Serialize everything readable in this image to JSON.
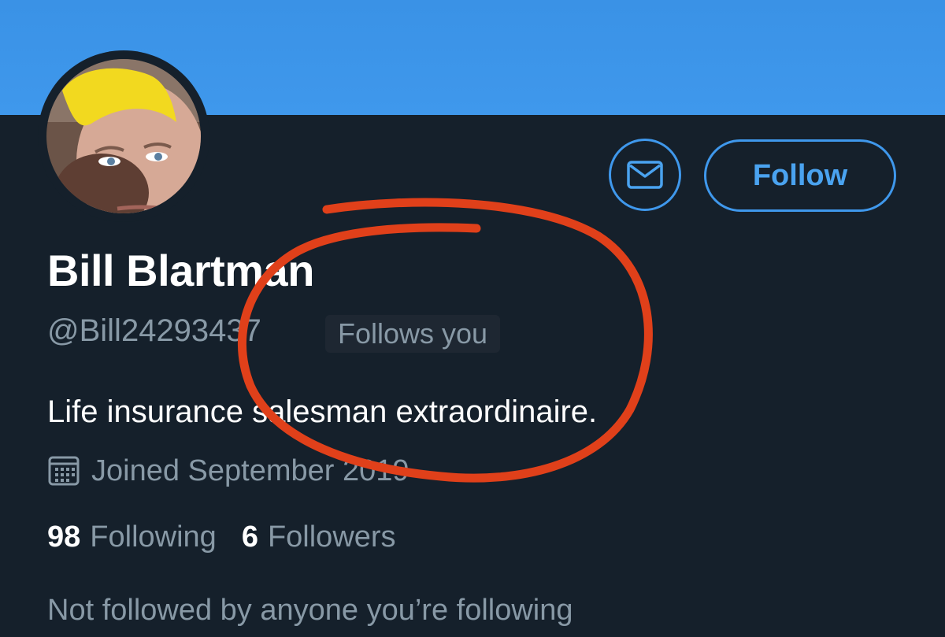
{
  "profile": {
    "name": "Bill Blartman",
    "handle": "@Bill24293437",
    "follows_you_badge": "Follows you",
    "bio": "Life insurance salesman extraordinaire.",
    "joined": "Joined September 2019"
  },
  "actions": {
    "follow_label": "Follow",
    "message_icon": "envelope-icon"
  },
  "stats": {
    "following_count": "98",
    "following_label": "Following",
    "followers_count": "6",
    "followers_label": "Followers"
  },
  "footer": {
    "mutuals_text": "Not followed by anyone you’re following"
  },
  "colors": {
    "background": "#15202b",
    "banner": "#3f98ec",
    "accent": "#4aa3f0",
    "secondary_text": "#8899a6",
    "annotation_circle": "#e0401a"
  },
  "icons": {
    "calendar": "calendar-icon"
  }
}
